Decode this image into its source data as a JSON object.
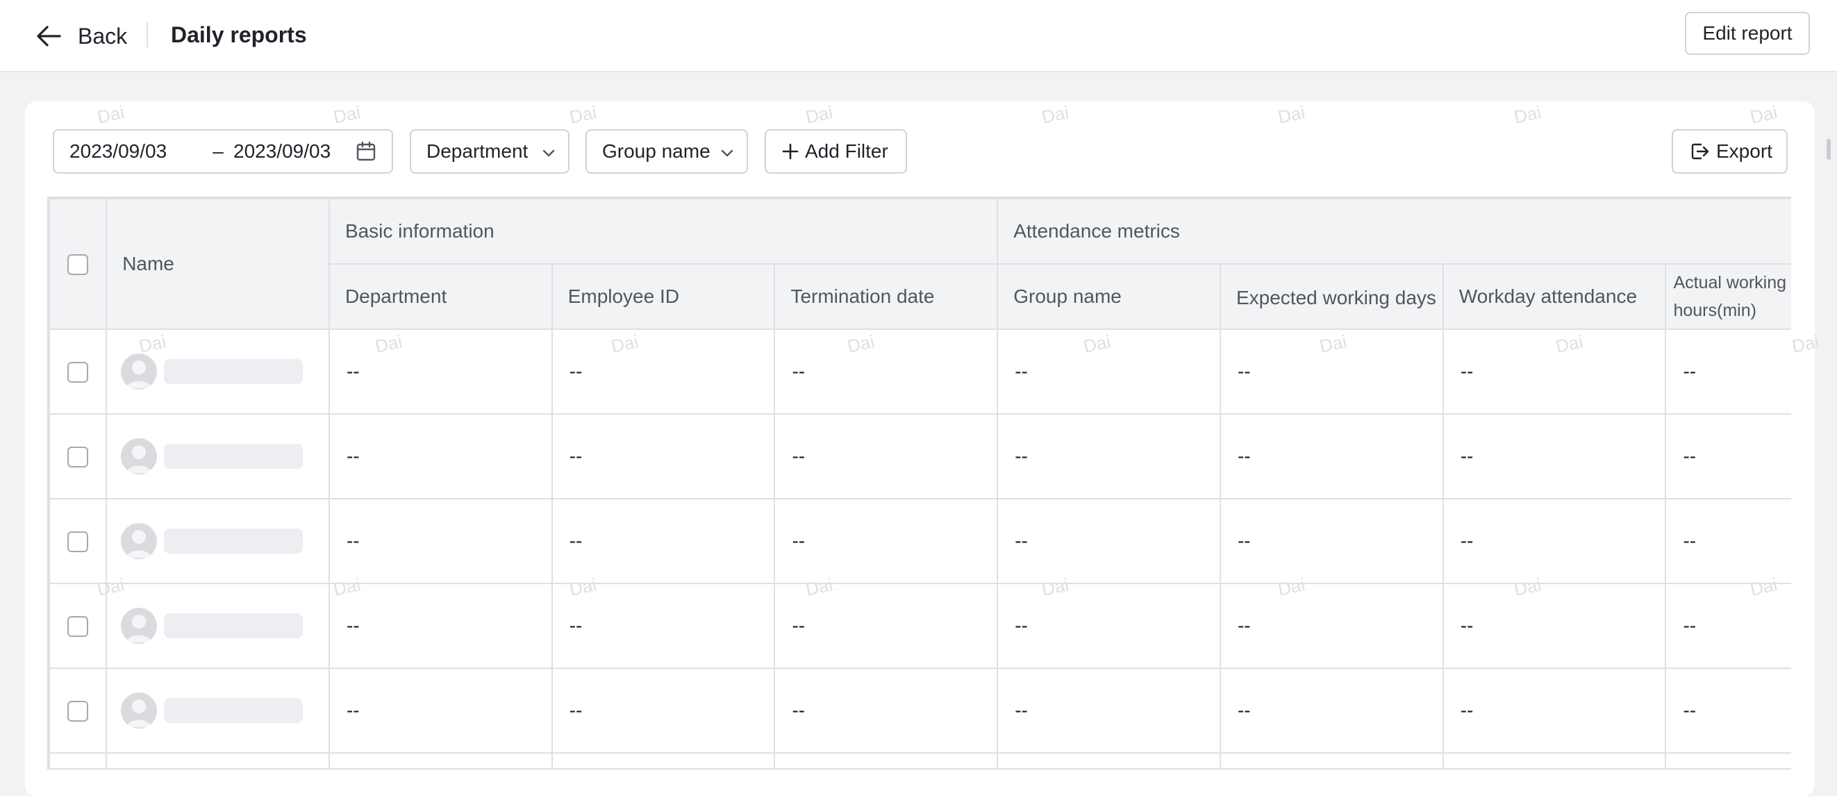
{
  "header": {
    "back_label": "Back",
    "title": "Daily reports",
    "edit_button": "Edit report"
  },
  "filters": {
    "date_start": "2023/09/03",
    "date_separator": "–",
    "date_end": "2023/09/03",
    "department": "Department",
    "group_name": "Group name",
    "add_filter": "Add Filter",
    "export": "Export"
  },
  "table": {
    "name_header": "Name",
    "group_headers": [
      "Basic information",
      "Attendance metrics"
    ],
    "columns": [
      "Department",
      "Employee ID",
      "Termination date",
      "Group name",
      "Expected working days",
      "Workday attendance",
      "Actual working hours(min)"
    ],
    "rows": [
      [
        "--",
        "--",
        "--",
        "--",
        "--",
        "--",
        "--"
      ],
      [
        "--",
        "--",
        "--",
        "--",
        "--",
        "--",
        "--"
      ],
      [
        "--",
        "--",
        "--",
        "--",
        "--",
        "--",
        "--"
      ],
      [
        "--",
        "--",
        "--",
        "--",
        "--",
        "--",
        "--"
      ],
      [
        "--",
        "--",
        "--",
        "--",
        "--",
        "--",
        "--"
      ]
    ]
  },
  "watermark": "Dai",
  "colors": {
    "background": "#f1f2f4",
    "header_bg": "#f2f3f5",
    "border": "#dee0e3",
    "text": "#1f2329"
  }
}
